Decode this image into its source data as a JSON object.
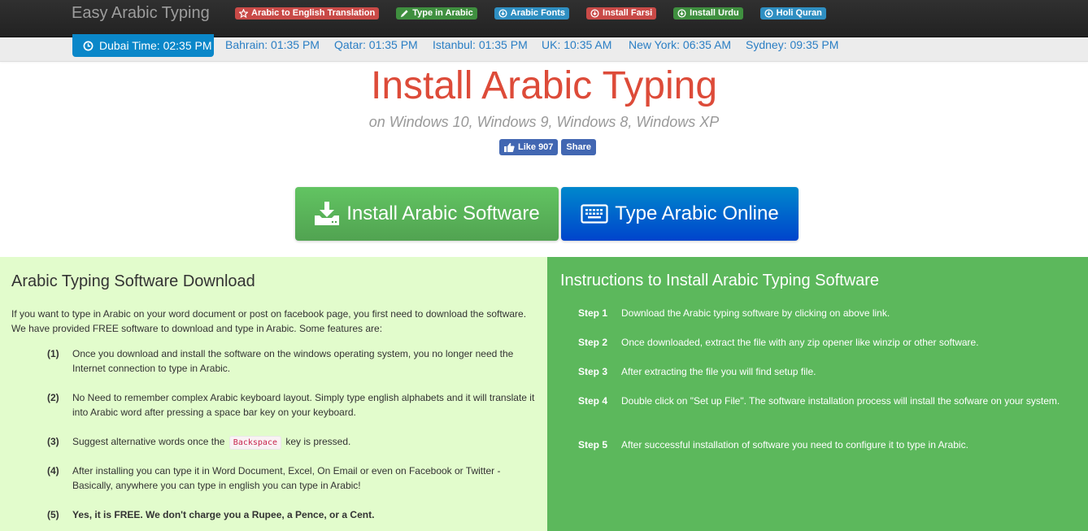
{
  "navbar": {
    "brand": "Easy Arabic Typing",
    "links": [
      {
        "label": "Arabic to English Translation",
        "icon": "star-icon",
        "color": "#c94a47"
      },
      {
        "label": "Type in Arabic",
        "icon": "pencil-icon",
        "color": "#3f8f3f"
      },
      {
        "label": "Arabic Fonts",
        "icon": "download-circle-icon",
        "color": "#2f8fc2"
      },
      {
        "label": "Install Farsi",
        "icon": "download-circle-icon",
        "color": "#c94a47"
      },
      {
        "label": "Install Urdu",
        "icon": "download-circle-icon",
        "color": "#3f8f3f"
      },
      {
        "label": "Holi Quran",
        "icon": "download-circle-icon",
        "color": "#2f8fc2"
      }
    ]
  },
  "timebar": {
    "active": "Dubai Time: 02:35 PM",
    "times": [
      "Bahrain: 01:35 PM",
      "Qatar: 01:35 PM",
      "Istanbul: 01:35 PM",
      "UK: 10:35 AM",
      "New York: 06:35 AM",
      "Sydney: 09:35 PM"
    ]
  },
  "header": {
    "title": "Install Arabic Typing",
    "subtitle": "on Windows 10, Windows 9, Windows 8, Windows XP",
    "like_label": "Like 907",
    "share_label": "Share"
  },
  "actions": {
    "install_label": "Install Arabic Software",
    "type_label": "Type Arabic Online"
  },
  "left_panel": {
    "title": "Arabic Typing Software Download",
    "intro": "If you want to type in Arabic on your word document or post on facebook page, you first need to download the software. We have provided FREE software to download and type in Arabic. Some features are:",
    "features": [
      {
        "num": "(1)",
        "text": "Once you download and install the software on the windows operating system, you no longer need the Internet connection to type in Arabic."
      },
      {
        "num": "(2)",
        "text": "No Need to remember complex Arabic keyboard layout. Simply type english alphabets and it will translate it into Arabic word after pressing a space bar key on your keyboard."
      },
      {
        "num": "(3)",
        "text_before": "Suggest alternative words once the",
        "key": "Backspace",
        "text_after": "key is pressed."
      },
      {
        "num": "(4)",
        "text": "After installing you can type it in Word Document, Excel, On Email or even on Facebook or Twitter - Basically, anywhere you can type in english you can type in Arabic!"
      },
      {
        "num": "(5)",
        "text": "Yes, it is FREE. We don't charge you a Rupee, a Pence, or a Cent."
      }
    ]
  },
  "right_panel": {
    "title": "Instructions to Install Arabic Typing Software",
    "steps": [
      {
        "label": "Step 1",
        "text": "Download the Arabic typing software by clicking on above link."
      },
      {
        "label": "Step 2",
        "text": "Once downloaded, extract the file with any zip opener like winzip or other software."
      },
      {
        "label": "Step 3",
        "text": "After extracting the file you will find setup file."
      },
      {
        "label": "Step 4",
        "text": "Double click on \"Set up File\". The software installation process will install the sofware on your system."
      },
      {
        "label": "Step 5",
        "text": "After successful installation of software you need to configure it to type in Arabic."
      }
    ]
  }
}
